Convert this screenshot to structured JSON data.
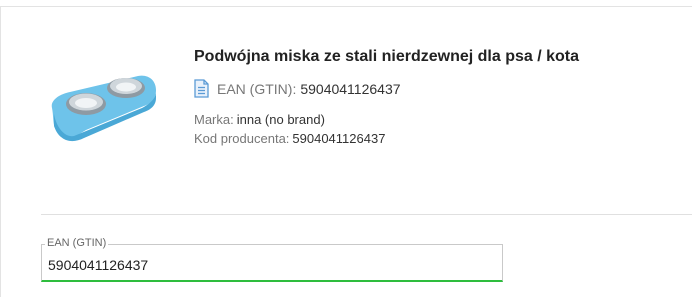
{
  "product": {
    "title": "Podwójna miska ze stali nierdzewnej dla psa / kota",
    "ean_label": "EAN (GTIN):",
    "ean_value": "5904041126437",
    "brand_label": "Marka:",
    "brand_value": "inna (no brand)",
    "producer_code_label": "Kod producenta:",
    "producer_code_value": "5904041126437",
    "image_icon": "double-pet-bowl-image",
    "doc_icon": "document-icon"
  },
  "form": {
    "ean_field_label": "EAN (GTIN)",
    "ean_field_value": "5904041126437"
  },
  "colors": {
    "accent_green": "#2ebd3e",
    "bowl_blue": "#6ec3ea",
    "doc_icon_blue": "#5b9bd5"
  }
}
